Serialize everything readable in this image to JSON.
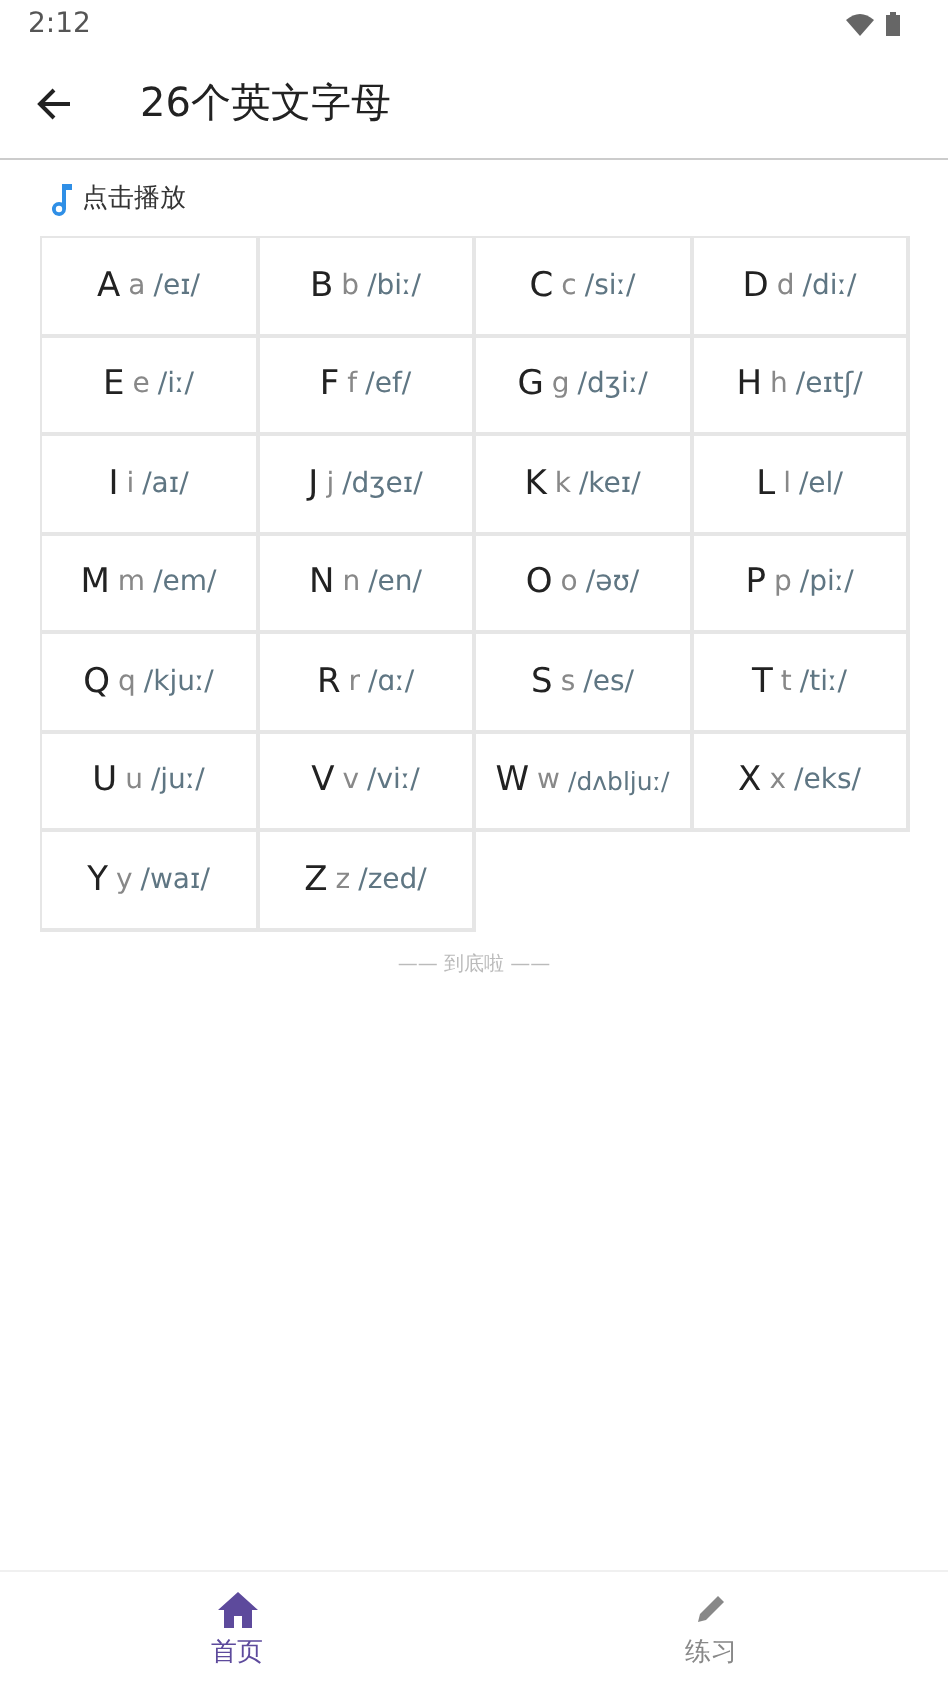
{
  "status_bar": {
    "time": "2:12"
  },
  "app_bar": {
    "title": "26个英文字母"
  },
  "play_hint": "点击播放",
  "letters": [
    {
      "upper": "A",
      "lower": "a",
      "phonetic": "/eɪ/"
    },
    {
      "upper": "B",
      "lower": "b",
      "phonetic": "/biː/"
    },
    {
      "upper": "C",
      "lower": "c",
      "phonetic": "/siː/"
    },
    {
      "upper": "D",
      "lower": "d",
      "phonetic": "/diː/"
    },
    {
      "upper": "E",
      "lower": "e",
      "phonetic": "/iː/"
    },
    {
      "upper": "F",
      "lower": "f",
      "phonetic": "/ef/"
    },
    {
      "upper": "G",
      "lower": "g",
      "phonetic": "/dʒiː/"
    },
    {
      "upper": "H",
      "lower": "h",
      "phonetic": "/eɪtʃ/"
    },
    {
      "upper": "I",
      "lower": "i",
      "phonetic": "/aɪ/"
    },
    {
      "upper": "J",
      "lower": "j",
      "phonetic": "/dʒeɪ/"
    },
    {
      "upper": "K",
      "lower": "k",
      "phonetic": "/keɪ/"
    },
    {
      "upper": "L",
      "lower": "l",
      "phonetic": "/el/"
    },
    {
      "upper": "M",
      "lower": "m",
      "phonetic": "/em/"
    },
    {
      "upper": "N",
      "lower": "n",
      "phonetic": "/en/"
    },
    {
      "upper": "O",
      "lower": "o",
      "phonetic": "/əʊ/"
    },
    {
      "upper": "P",
      "lower": "p",
      "phonetic": "/piː/"
    },
    {
      "upper": "Q",
      "lower": "q",
      "phonetic": "/kjuː/"
    },
    {
      "upper": "R",
      "lower": "r",
      "phonetic": "/ɑː/"
    },
    {
      "upper": "S",
      "lower": "s",
      "phonetic": "/es/"
    },
    {
      "upper": "T",
      "lower": "t",
      "phonetic": "/tiː/"
    },
    {
      "upper": "U",
      "lower": "u",
      "phonetic": "/juː/"
    },
    {
      "upper": "V",
      "lower": "v",
      "phonetic": "/viː/"
    },
    {
      "upper": "W",
      "lower": "w",
      "phonetic": "/dʌbljuː/"
    },
    {
      "upper": "X",
      "lower": "x",
      "phonetic": "/eks/"
    },
    {
      "upper": "Y",
      "lower": "y",
      "phonetic": "/waɪ/"
    },
    {
      "upper": "Z",
      "lower": "z",
      "phonetic": "/zed/"
    }
  ],
  "end_note": "—— 到底啦 ——",
  "bottom_nav": [
    {
      "label": "首页",
      "kind": "home",
      "selected": true
    },
    {
      "label": "练习",
      "kind": "practice",
      "selected": false
    }
  ]
}
